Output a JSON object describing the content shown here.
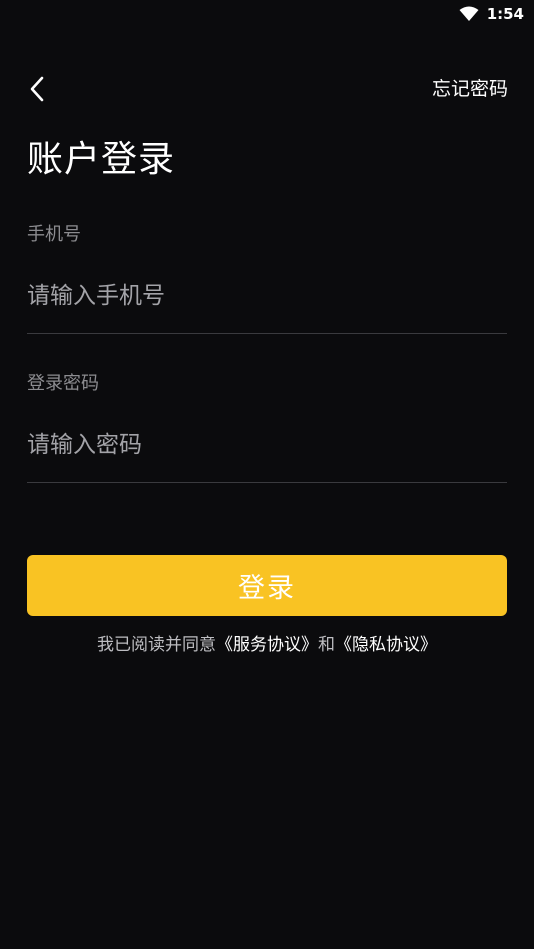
{
  "status_bar": {
    "time": "1:54",
    "wifi_icon": "wifi-icon"
  },
  "nav": {
    "back_icon": "chevron-left-icon",
    "forgot_password": "忘记密码"
  },
  "title": "账户登录",
  "phone": {
    "label": "手机号",
    "placeholder": "请输入手机号",
    "value": ""
  },
  "password": {
    "label": "登录密码",
    "placeholder": "请输入密码",
    "value": ""
  },
  "login_button": {
    "label": "登录"
  },
  "agreement": {
    "prefix": "我已阅读并同意",
    "service_link": "《服务协议》",
    "connector": "和",
    "privacy_link": "《隐私协议》"
  },
  "colors": {
    "background": "#0b0b0d",
    "accent": "#f9c323",
    "label": "#8c8c90",
    "divider": "#3a3a3e"
  }
}
